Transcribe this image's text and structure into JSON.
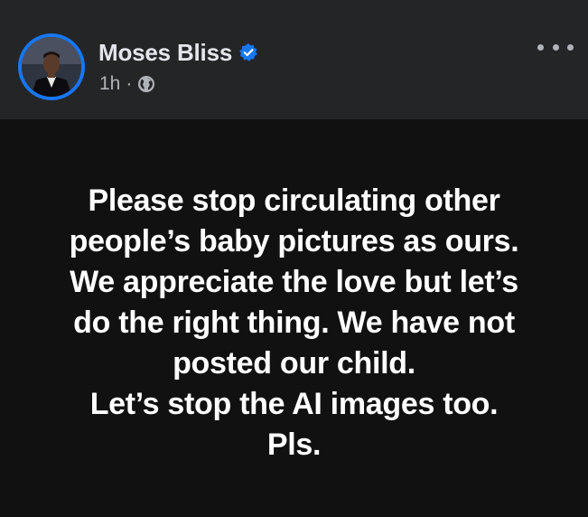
{
  "post": {
    "author_name": "Moses Bliss",
    "verified_icon": "verified-badge-icon",
    "time": "1h",
    "separator": "·",
    "audience_icon": "globe-icon",
    "more_icon": "more-options-icon",
    "text_lines": [
      "Please stop circulating other",
      "people’s baby pictures as ours.",
      "We appreciate the love but let’s",
      "do the right thing. We have not",
      "posted our child.",
      "Let’s stop the AI images too.",
      "Pls."
    ]
  },
  "colors": {
    "header_bg": "#242526",
    "post_bg": "#111111",
    "accent": "#1877f2",
    "secondary_text": "#b0b3b8"
  }
}
